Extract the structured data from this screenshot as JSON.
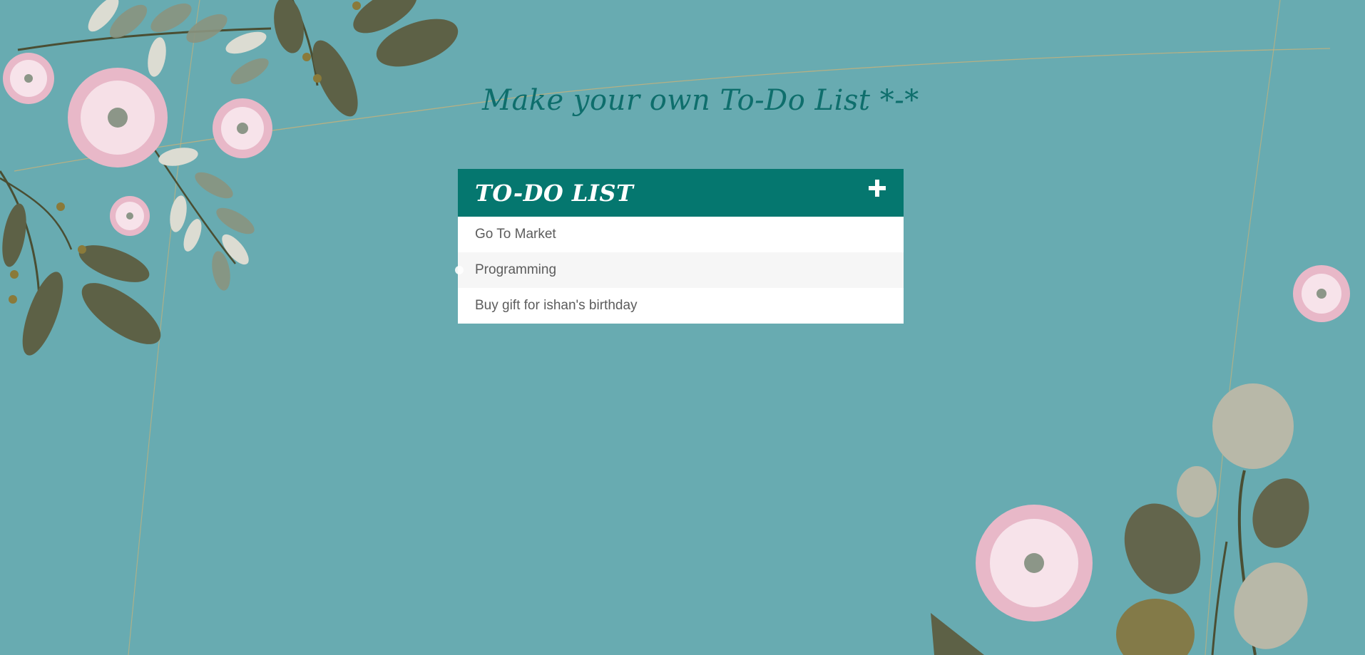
{
  "page": {
    "title": "Make your own To-Do List *-*"
  },
  "todo": {
    "heading": "TO-DO LIST",
    "add_icon": "plus-icon",
    "items": [
      {
        "label": "Go To Market"
      },
      {
        "label": "Programming"
      },
      {
        "label": "Buy gift for ishan's birthday"
      }
    ]
  },
  "colors": {
    "background": "#68abb1",
    "header": "#05776f",
    "title": "#0e6e6c",
    "item_text": "#5c5c5c"
  }
}
